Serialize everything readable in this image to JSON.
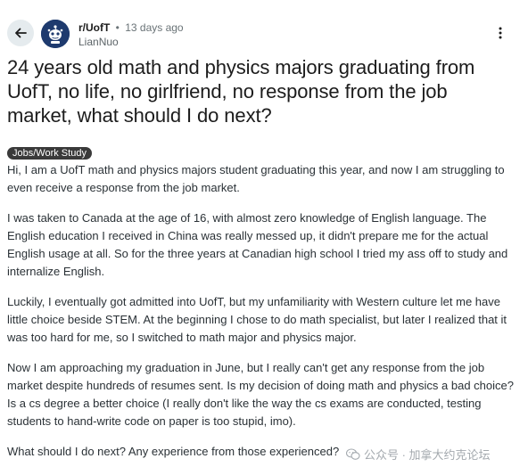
{
  "header": {
    "subreddit": "r/UofT",
    "separator": "•",
    "time_ago": "13 days ago",
    "author": "LianNuo"
  },
  "icons": {
    "back": "arrow-left-icon",
    "avatar": "uoft-logo-avatar",
    "more": "more-vertical-icon"
  },
  "post": {
    "title": "24 years old math and physics majors graduating from UofT, no life, no girlfriend, no response from the job market, what should I do next?",
    "flair": "Jobs/Work Study",
    "paragraphs": [
      "Hi, I am a UofT math and physics majors student graduating this year, and now I am struggling to even receive a response from the job market.",
      "I was taken to Canada at the age of 16, with almost zero knowledge of English language. The English education I received in China was really messed up, it didn't prepare me for the actual English usage at all. So for the three years at Canadian high school I tried my ass off to study and internalize English.",
      "Luckily, I eventually got admitted into UofT, but my unfamiliarity with Western culture let me have little choice beside STEM. At the beginning I chose to do math specialist, but later I realized that it was too hard for me, so I switched to math major and physics major.",
      "Now I am approaching my graduation in June, but I really can't get any response from the job market despite hundreds of resumes sent. Is my decision of doing math and physics a bad choice? Is a cs degree a better choice (I really don't like the way the cs exams are conducted, testing students to hand-write code on paper is too stupid, imo).",
      "What should I do next? Any experience from those experienced?"
    ]
  },
  "watermark": {
    "text": "公众号 · 加拿大约克论坛"
  },
  "colors": {
    "flair_bg": "#3a3a3a",
    "avatar_bg": "#1e3a6e",
    "back_btn_bg": "#e5ebee"
  }
}
